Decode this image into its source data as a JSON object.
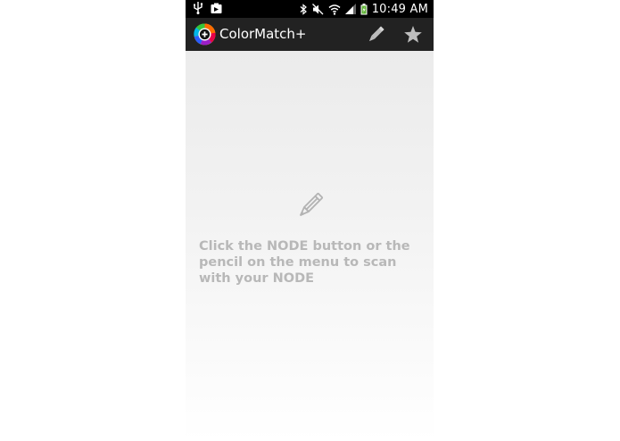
{
  "status_bar": {
    "time": "10:49 AM",
    "icons": [
      "usb-icon",
      "screenshot-notification-icon",
      "bluetooth-icon",
      "mute-icon",
      "wifi-icon",
      "signal-icon",
      "battery-charging-icon"
    ]
  },
  "action_bar": {
    "title": "ColorMatch+",
    "logo_icon": "colormatch-logo-icon",
    "actions": [
      "pencil-icon",
      "star-icon"
    ]
  },
  "empty_state": {
    "icon": "pencil-icon",
    "message": "Click the NODE button or the pencil on the menu to scan with your NODE"
  },
  "colors": {
    "status_bar_bg": "#000000",
    "action_bar_bg": "#222222",
    "message_text": "#b8b8b8",
    "icon_gray": "#bdbdbd"
  }
}
